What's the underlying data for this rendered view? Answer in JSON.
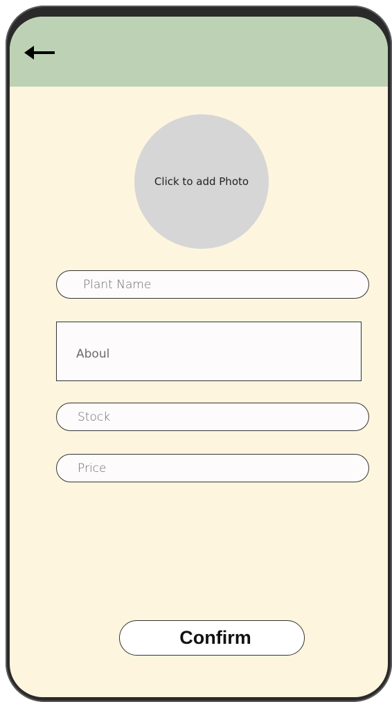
{
  "header": {
    "back_icon": "arrow-left-icon",
    "color": "#bdd2b5"
  },
  "photo": {
    "label": "Click to add Photo",
    "color": "#d6d6d6"
  },
  "form": {
    "plant_name_placeholder": "Plant Name",
    "about_placeholder": "Aboul",
    "stock_placeholder": "Stock",
    "price_placeholder": "Price"
  },
  "actions": {
    "confirm_label": "Confirm"
  },
  "theme": {
    "background": "#fdf5dd"
  }
}
